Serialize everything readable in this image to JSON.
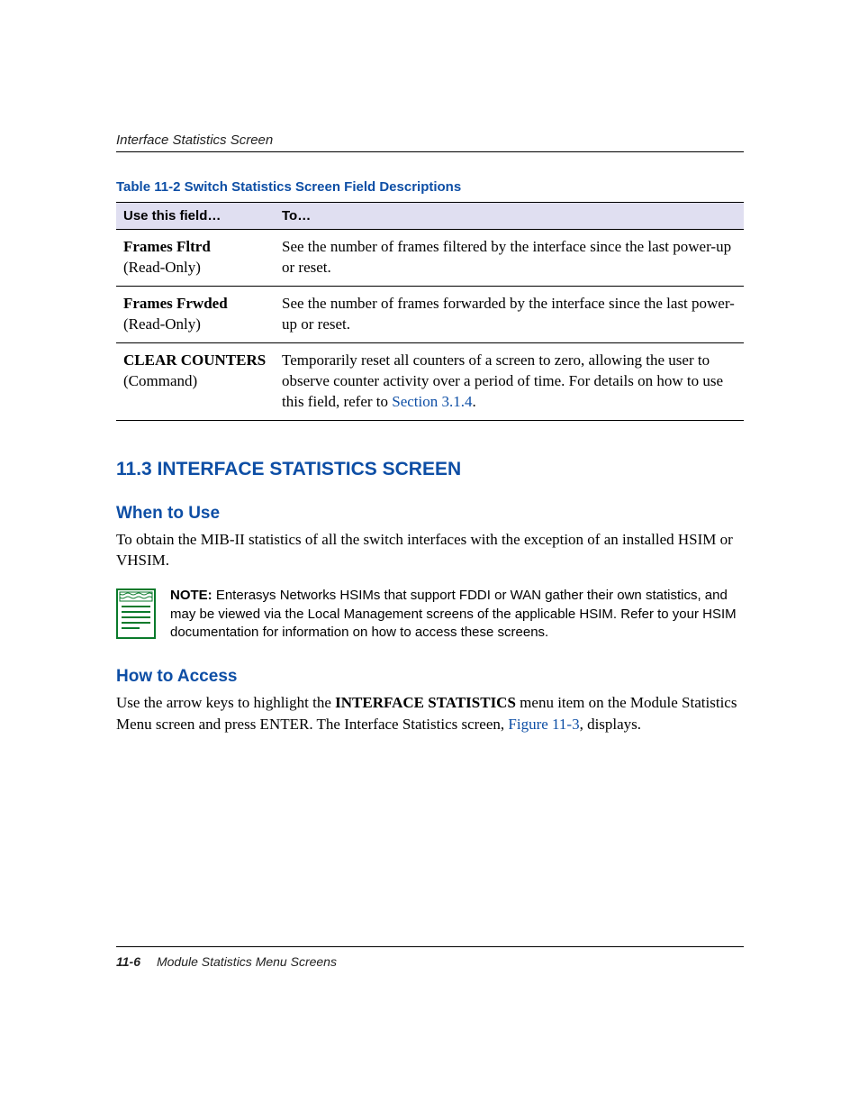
{
  "runningHead": "Interface Statistics Screen",
  "tableCaption": "Table 11-2   Switch Statistics Screen Field Descriptions",
  "tableHeaders": {
    "col1": "Use this field…",
    "col2": "To…"
  },
  "rows": [
    {
      "fieldName": "Frames Fltrd",
      "fieldType": "(Read-Only)",
      "desc": "See the number of frames filtered by the interface since the last power-up or reset."
    },
    {
      "fieldName": "Frames Frwded",
      "fieldType": "(Read-Only)",
      "desc": "See the number of frames forwarded by the interface since the last power-up or reset."
    },
    {
      "fieldName": "CLEAR COUNTERS",
      "fieldType": "(Command)",
      "descPrefix": "Temporarily reset all counters of a screen to zero, allowing the user to observe counter activity over a period of time. For details on how to use this field, refer to ",
      "descLink": "Section 3.1.4",
      "descSuffix": "."
    }
  ],
  "sectionHeading": "11.3   INTERFACE STATISTICS SCREEN",
  "whenToUseHeading": "When to Use",
  "whenToUseBody": "To obtain the MIB-II statistics of all the switch interfaces with the exception of an installed HSIM or VHSIM.",
  "note": {
    "label": "NOTE:",
    "text": " Enterasys Networks HSIMs that support FDDI or WAN gather their own statistics, and may be viewed via the Local Management screens of the applicable HSIM. Refer to your HSIM documentation for information on how to access these screens."
  },
  "howToAccessHeading": "How to Access",
  "howTo": {
    "prefix": "Use the arrow keys to highlight the ",
    "strong": "INTERFACE STATISTICS",
    "mid": " menu item on the Module Statistics Menu screen and press ENTER. The Interface Statistics screen, ",
    "link": "Figure 11-3",
    "suffix": ", displays."
  },
  "footer": {
    "pageNum": "11-6",
    "title": "Module Statistics Menu Screens"
  }
}
